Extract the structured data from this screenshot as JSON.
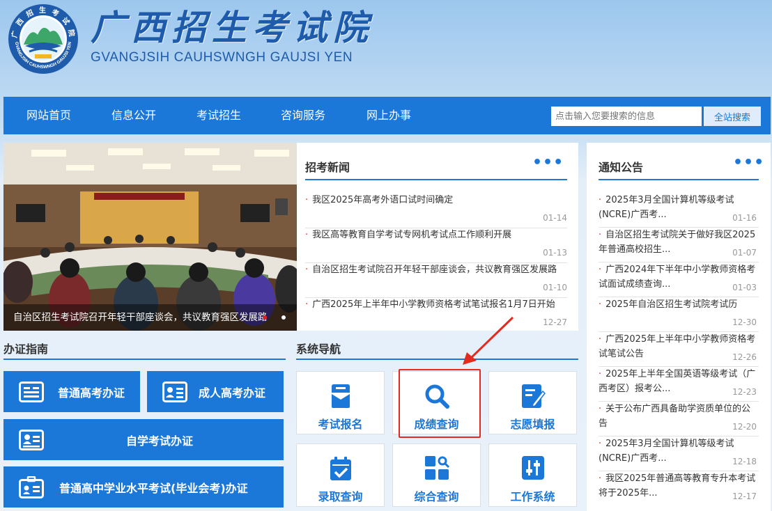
{
  "header": {
    "title_cn": "广西招生考试院",
    "title_en": "GVANGJSIH CAUHSWNGH GAUJSI YEN",
    "logo_text": "广西招生考试院 GVANGJSIH CAUHSWNGH GAUJSI YEN"
  },
  "nav": {
    "items": [
      "网站首页",
      "信息公开",
      "考试招生",
      "咨询服务",
      "网上办事"
    ],
    "search_placeholder": "点击输入您要搜索的信息",
    "search_button": "全站搜索"
  },
  "carousel": {
    "caption": "自治区招生考试院召开年轻干部座谈会，共议教育强区发展路",
    "active_index": 0,
    "slide_count": 2
  },
  "news": {
    "title": "招考新闻",
    "more": "•••",
    "items": [
      {
        "text": "我区2025年高考外语口试时间确定",
        "date": "01-14"
      },
      {
        "text": "我区高等教育自学考试专网机考试点工作顺利开展",
        "date": "01-13"
      },
      {
        "text": "自治区招生考试院召开年轻干部座谈会，共议教育强区发展路",
        "date": "01-10"
      },
      {
        "text": "广西2025年上半年中小学教师资格考试笔试报名1月7日开始",
        "date": "12-27"
      }
    ]
  },
  "notices": {
    "title": "通知公告",
    "more": "•••",
    "items": [
      {
        "text": "2025年3月全国计算机等级考试(NCRE)广西考...",
        "date": "01-16"
      },
      {
        "text": "自治区招生考试院关于做好我区2025年普通高校招生...",
        "date": "01-07"
      },
      {
        "text": "广西2024年下半年中小学教师资格考试面试成绩查询...",
        "date": "01-03"
      },
      {
        "text": "2025年自治区招生考试院考试历",
        "date": "12-30"
      },
      {
        "text": "广西2025年上半年中小学教师资格考试笔试公告",
        "date": "12-26"
      },
      {
        "text": "2025年上半年全国英语等级考试（广西考区）报考公...",
        "date": "12-23"
      },
      {
        "text": "关于公布广西具备助学资质单位的公告",
        "date": "12-20"
      },
      {
        "text": "2025年3月全国计算机等级考试(NCRE)广西考...",
        "date": "12-18"
      },
      {
        "text": "我区2025年普通高等教育专升本考试将于2025年...",
        "date": "12-17"
      }
    ]
  },
  "guide": {
    "title": "办证指南",
    "buttons": [
      "普通高考办证",
      "成人高考办证",
      "自学考试办证",
      "普通高中学业水平考试(毕业会考)办证"
    ]
  },
  "sysnav": {
    "title": "系统导航",
    "tiles": [
      "考试报名",
      "成绩查询",
      "志愿填报",
      "录取查询",
      "综合查询",
      "工作系统"
    ],
    "highlighted": "成绩查询"
  },
  "colors": {
    "brand_blue": "#1b77d8",
    "bullet_red": "#e02020",
    "highlight_red": "#e4291f"
  }
}
